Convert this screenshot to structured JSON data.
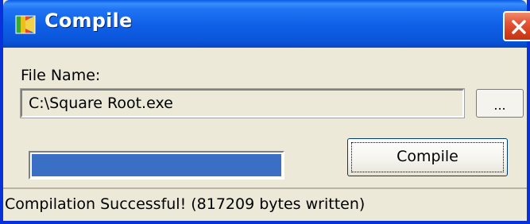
{
  "window": {
    "title": "Compile",
    "icon": "app-icon",
    "close_icon": "close-icon"
  },
  "form": {
    "file_name_label": "File Name:",
    "file_name_value": "C:\\Square Root.exe",
    "browse_label": "...",
    "compile_label": "Compile"
  },
  "progress": {
    "fraction": 1.0
  },
  "status": {
    "text": "Compilation Successful! (817209 bytes written)"
  },
  "colors": {
    "titlebar": "#0a5ce8",
    "progress_fill": "#3a6fc4",
    "close_button": "#d6401f",
    "window_bg": "#ece9d8"
  }
}
